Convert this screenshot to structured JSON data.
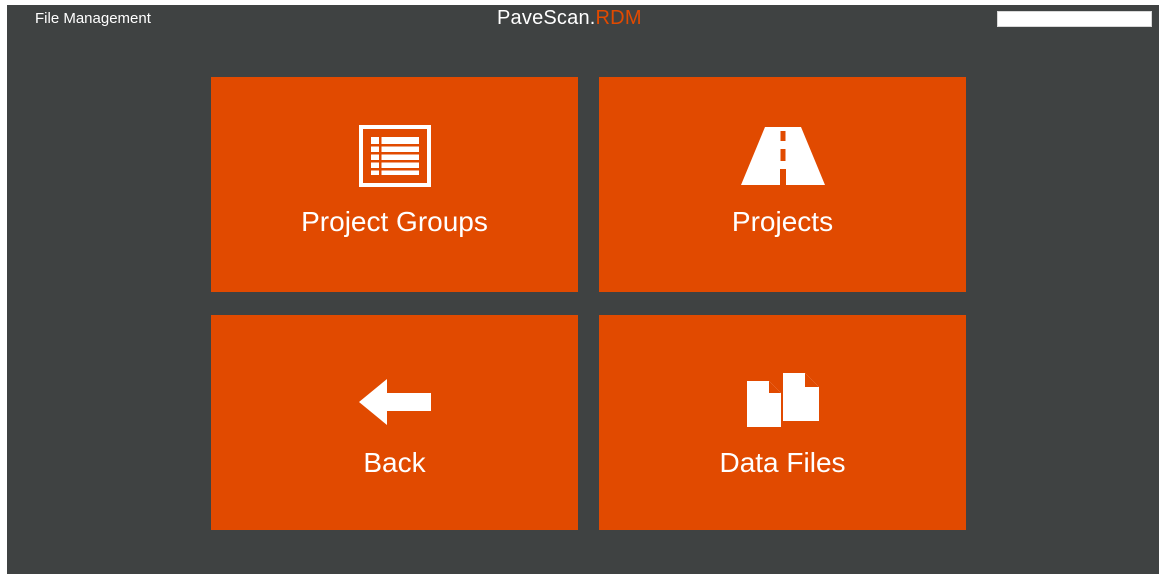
{
  "header": {
    "window_title": "File Management",
    "brand_main": "PaveScan.",
    "brand_accent": "RDM",
    "search_value": ""
  },
  "tiles": [
    {
      "label": "Project Groups",
      "icon": "list-icon"
    },
    {
      "label": "Projects",
      "icon": "road-icon"
    },
    {
      "label": "Back",
      "icon": "arrow-left-icon"
    },
    {
      "label": "Data Files",
      "icon": "files-icon"
    }
  ],
  "colors": {
    "background": "#3f4242",
    "accent": "#e14a00",
    "text": "#ffffff"
  }
}
